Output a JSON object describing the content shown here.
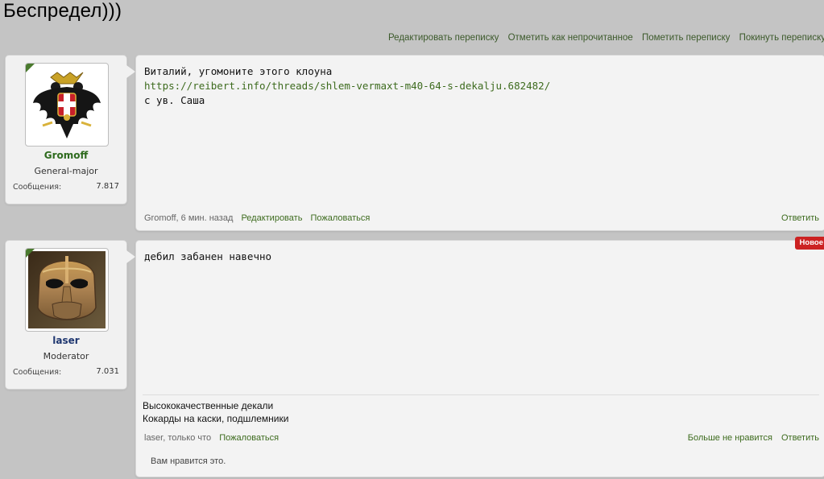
{
  "thread_title": "Беспредел)))",
  "conversation_links": [
    "Редактировать переписку",
    "Отметить как непрочитанное",
    "Пометить переписку",
    "Покинуть переписку"
  ],
  "messages": [
    {
      "user": {
        "name": "Gromoff",
        "title": "General-major",
        "stat_label": "Сообщения:",
        "stat_value": "7.817",
        "name_color": "#2e6b1e"
      },
      "text_lines": [
        "Виталий, угомоните этого клоуна",
        "с ув. Саша"
      ],
      "link": "https://reibert.info/threads/shlem-vermaxt-m40-64-s-dekalju.682482/",
      "meta": "Gromoff, 6 мин. назад",
      "actions": [
        "Редактировать",
        "Пожаловаться"
      ],
      "reply": "Ответить"
    },
    {
      "user": {
        "name": "laser",
        "title": "Moderator",
        "stat_label": "Сообщения:",
        "stat_value": "7.031",
        "name_color": "#1f3770"
      },
      "badge": "Новое",
      "text_lines": [
        "дебил забанен навечно"
      ],
      "signature": [
        "Высококачественные декали",
        "Кокарды на каски, подшлемники"
      ],
      "meta": "laser, только что",
      "actions": [
        "Пожаловаться"
      ],
      "right_actions": [
        "Больше не нравится",
        "Ответить"
      ],
      "likes": "Вам нравится это."
    }
  ],
  "colors": {
    "accent": "#3d6b1e",
    "badge": "#cc2222",
    "background": "#c4c4c4"
  }
}
